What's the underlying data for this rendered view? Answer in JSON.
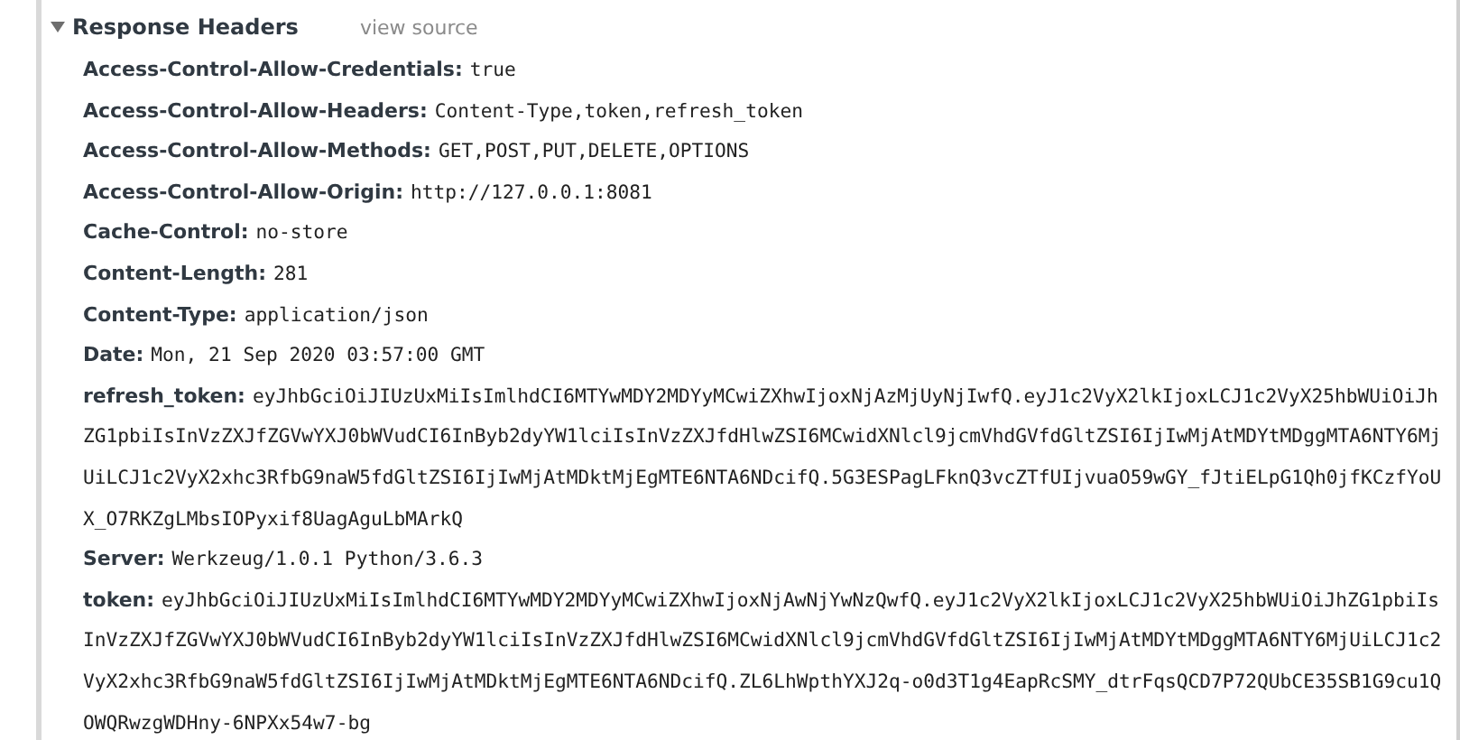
{
  "section": {
    "title": "Response Headers",
    "expanded": true,
    "link": "view source"
  },
  "headers": [
    {
      "name": "Access-Control-Allow-Credentials:",
      "value": "true"
    },
    {
      "name": "Access-Control-Allow-Headers:",
      "value": "Content-Type,token,refresh_token"
    },
    {
      "name": "Access-Control-Allow-Methods:",
      "value": "GET,POST,PUT,DELETE,OPTIONS"
    },
    {
      "name": "Access-Control-Allow-Origin:",
      "value": "http://127.0.0.1:8081"
    },
    {
      "name": "Cache-Control:",
      "value": "no-store"
    },
    {
      "name": "Content-Length:",
      "value": "281"
    },
    {
      "name": "Content-Type:",
      "value": "application/json"
    },
    {
      "name": "Date:",
      "value": "Mon, 21 Sep 2020 03:57:00 GMT"
    },
    {
      "name": "refresh_token:",
      "value": "eyJhbGciOiJIUzUxMiIsImlhdCI6MTYwMDY2MDYyMCwiZXhwIjoxNjAzMjUyNjIwfQ.eyJ1c2VyX2lkIjoxLCJ1c2VyX25hbWUiOiJhZG1pbiIsInVzZXJfZGVwYXJ0bWVudCI6InByb2dyYW1lciIsInVzZXJfdHlwZSI6MCwidXNlcl9jcmVhdGVfdGltZSI6IjIwMjAtMDYtMDggMTA6NTY6MjUiLCJ1c2VyX2xhc3RfbG9naW5fdGltZSI6IjIwMjAtMDktMjEgMTE6NTA6NDcifQ.5G3ESPagLFknQ3vcZTfUIjvuaO59wGY_fJtiELpG1Qh0jfKCzfYoUX_O7RKZgLMbsIOPyxif8UagAguLbMArkQ"
    },
    {
      "name": "Server:",
      "value": "Werkzeug/1.0.1 Python/3.6.3"
    },
    {
      "name": "token:",
      "value": "eyJhbGciOiJIUzUxMiIsImlhdCI6MTYwMDY2MDYyMCwiZXhwIjoxNjAwNjYwNzQwfQ.eyJ1c2VyX2lkIjoxLCJ1c2VyX25hbWUiOiJhZG1pbiIsInVzZXJfZGVwYXJ0bWVudCI6InByb2dyYW1lciIsInVzZXJfdHlwZSI6MCwidXNlcl9jcmVhdGVfdGltZSI6IjIwMjAtMDYtMDggMTA6NTY6MjUiLCJ1c2VyX2xhc3RfbG9naW5fdGltZSI6IjIwMjAtMDktMjEgMTE6NTA6NDcifQ.ZL6LhWpthYXJ2q-o0d3T1g4EapRcSMY_dtrFqsQCD7P72QUbCE35SB1G9cu1QOWQRwzgWDHny-6NPXx54w7-bg"
    }
  ]
}
